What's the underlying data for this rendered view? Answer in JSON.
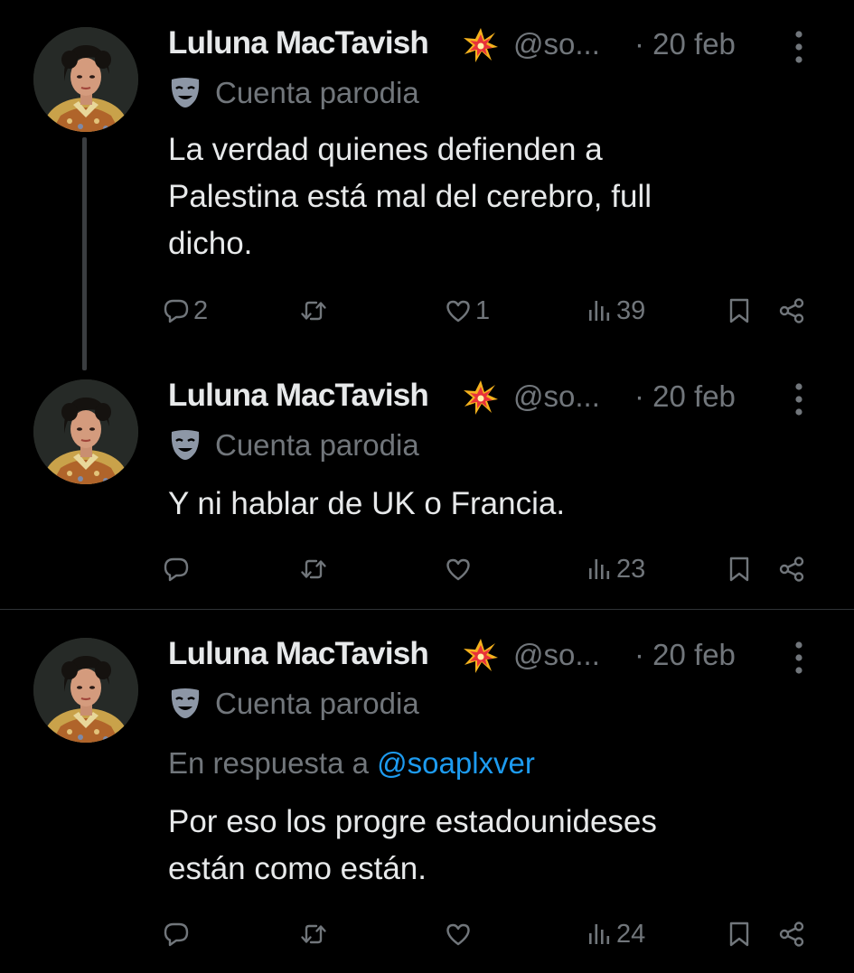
{
  "tweets": [
    {
      "author_name": "Luluna MacTavish",
      "handle": "@so...",
      "date": "· 20 feb",
      "parody_label": "Cuenta parodia",
      "reply_prefix": "",
      "reply_mention": "",
      "text": "La verdad quienes defienden a\nPalestina está mal del cerebro, full\ndicho.",
      "replies": "2",
      "retweets": "",
      "likes": "1",
      "views": "39"
    },
    {
      "author_name": "Luluna MacTavish",
      "handle": "@so...",
      "date": "· 20 feb",
      "parody_label": "Cuenta parodia",
      "reply_prefix": "",
      "reply_mention": "",
      "text": "Y ni hablar de UK o Francia.",
      "replies": "",
      "retweets": "",
      "likes": "",
      "views": "23"
    },
    {
      "author_name": "Luluna MacTavish",
      "handle": "@so...",
      "date": "· 20 feb",
      "parody_label": "Cuenta parodia",
      "reply_prefix": "En respuesta a ",
      "reply_mention": "@soaplxver",
      "text": "Por eso los progre estadounideses\nestán como están.",
      "replies": "",
      "retweets": "",
      "likes": "",
      "views": "24"
    }
  ],
  "colors": {
    "background": "#000000",
    "text_primary": "#e7e9ea",
    "text_secondary": "#71767b",
    "link": "#1d9bf0",
    "divider": "#2f3336"
  },
  "icons": {
    "name_emoji": "collision-sparkle-icon",
    "parody": "theater-mask-icon",
    "more": "more-vertical-icon",
    "reply": "reply-bubble-icon",
    "retweet": "retweet-icon",
    "like": "heart-icon",
    "views": "views-bar-chart-icon",
    "bookmark": "bookmark-icon",
    "share": "share-icon"
  }
}
